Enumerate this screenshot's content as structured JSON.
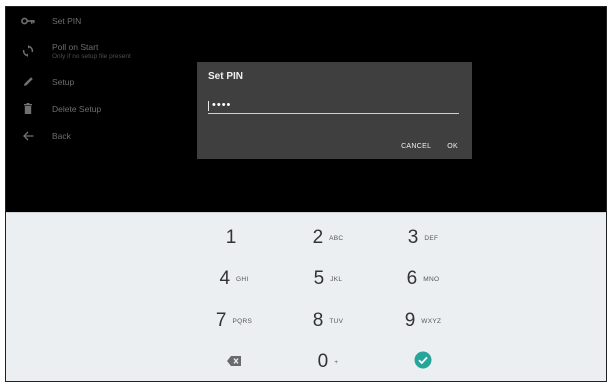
{
  "menu": {
    "items": [
      {
        "label": "Set PIN",
        "icon": "key-icon"
      },
      {
        "label": "Poll on Start",
        "sublabel": "Only if no setup file present",
        "icon": "sync-icon"
      },
      {
        "label": "Setup",
        "icon": "pencil-icon"
      },
      {
        "label": "Delete Setup",
        "icon": "trash-icon"
      },
      {
        "label": "Back",
        "icon": "arrow-left-icon"
      }
    ]
  },
  "dialog": {
    "title": "Set PIN",
    "pin_value": "••••",
    "cancel_label": "CANCEL",
    "ok_label": "OK"
  },
  "keypad": {
    "keys": [
      {
        "digit": "1",
        "letters": ""
      },
      {
        "digit": "2",
        "letters": "ABC"
      },
      {
        "digit": "3",
        "letters": "DEF"
      },
      {
        "digit": "4",
        "letters": "GHI"
      },
      {
        "digit": "5",
        "letters": "JKL"
      },
      {
        "digit": "6",
        "letters": "MNO"
      },
      {
        "digit": "7",
        "letters": "PQRS"
      },
      {
        "digit": "8",
        "letters": "TUV"
      },
      {
        "digit": "9",
        "letters": "WXYZ"
      },
      {
        "digit": "0",
        "letters": "+"
      }
    ],
    "backspace_icon": "backspace-icon",
    "done_icon": "check-circle-icon"
  },
  "colors": {
    "screen_bg": "#000000",
    "dialog_bg": "#3f3f3f",
    "keypad_bg": "#eceff1",
    "accent": "#26a69a"
  }
}
